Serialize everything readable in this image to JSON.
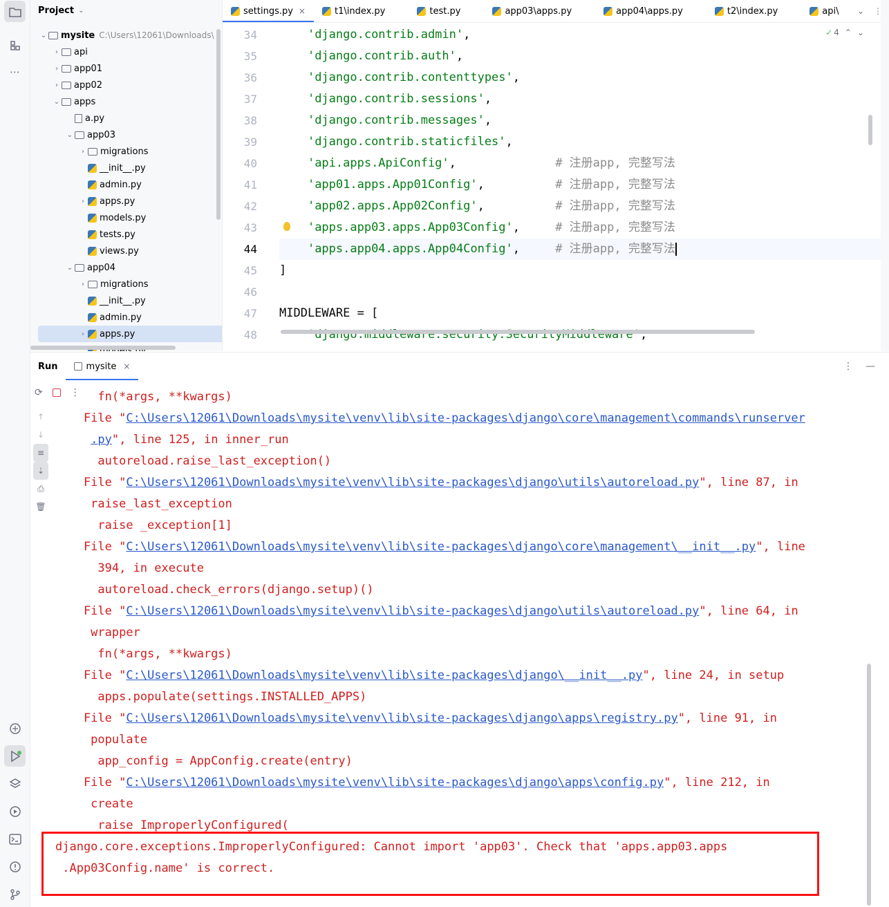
{
  "project": {
    "title": "Project",
    "root_name": "mysite",
    "root_path": "C:\\Users\\12061\\Downloads\\",
    "items": [
      {
        "label": "api",
        "type": "folder",
        "chevron": "right"
      },
      {
        "label": "app01",
        "type": "folder",
        "chevron": "right"
      },
      {
        "label": "app02",
        "type": "folder",
        "chevron": "right"
      },
      {
        "label": "apps",
        "type": "folder",
        "chevron": "down"
      },
      {
        "label": "a.py",
        "type": "file",
        "chevron": ""
      },
      {
        "label": "app03",
        "type": "folder",
        "chevron": "down"
      },
      {
        "label": "migrations",
        "type": "folder",
        "chevron": "right"
      },
      {
        "label": "__init__.py",
        "type": "py",
        "chevron": ""
      },
      {
        "label": "admin.py",
        "type": "py",
        "chevron": ""
      },
      {
        "label": "apps.py",
        "type": "py",
        "chevron": "right"
      },
      {
        "label": "models.py",
        "type": "py",
        "chevron": ""
      },
      {
        "label": "tests.py",
        "type": "py",
        "chevron": ""
      },
      {
        "label": "views.py",
        "type": "py",
        "chevron": ""
      },
      {
        "label": "app04",
        "type": "folder",
        "chevron": "down"
      },
      {
        "label": "migrations",
        "type": "folder",
        "chevron": "right"
      },
      {
        "label": "__init__.py",
        "type": "py",
        "chevron": ""
      },
      {
        "label": "admin.py",
        "type": "py",
        "chevron": ""
      },
      {
        "label": "apps.py",
        "type": "py",
        "chevron": "right"
      },
      {
        "label": "models.py",
        "type": "py",
        "chevron": ""
      }
    ]
  },
  "editor": {
    "tabs": [
      "settings.py",
      "t1\\index.py",
      "test.py",
      "app03\\apps.py",
      "app04\\apps.py",
      "t2\\index.py",
      "api\\"
    ],
    "inspection_count": "4",
    "line_numbers": [
      "34",
      "35",
      "36",
      "37",
      "38",
      "39",
      "40",
      "41",
      "42",
      "43",
      "44",
      "45",
      "46",
      "47",
      "48"
    ],
    "lines": [
      {
        "s": "'django.contrib.admin'",
        "t": ",",
        "c": ""
      },
      {
        "s": "'django.contrib.auth'",
        "t": ",",
        "c": ""
      },
      {
        "s": "'django.contrib.contenttypes'",
        "t": ",",
        "c": ""
      },
      {
        "s": "'django.contrib.sessions'",
        "t": ",",
        "c": ""
      },
      {
        "s": "'django.contrib.messages'",
        "t": ",",
        "c": ""
      },
      {
        "s": "'django.contrib.staticfiles'",
        "t": ",",
        "c": ""
      },
      {
        "s": "'api.apps.ApiConfig'",
        "t": ",              ",
        "c": "# 注册app, 完整写法"
      },
      {
        "s": "'app01.apps.App01Config'",
        "t": ",          ",
        "c": "# 注册app, 完整写法"
      },
      {
        "s": "'app02.apps.App02Config'",
        "t": ",          ",
        "c": "# 注册app, 完整写法"
      },
      {
        "s": "'apps.app03.apps.App03Config'",
        "t": ",     ",
        "c": "# 注册app, 完整写法"
      },
      {
        "s": "'apps.app04.apps.App04Config'",
        "t": ",     ",
        "c": "# 注册app, 完整写法"
      },
      {
        "p": "]"
      },
      {
        "p": ""
      },
      {
        "p": "MIDDLEWARE = ["
      },
      {
        "s": "'django.middleware.security.SecurityMiddleware'",
        "t": ",",
        "c": ""
      }
    ]
  },
  "run": {
    "title": "Run",
    "tab_label": "mysite",
    "console": [
      {
        "pre": "      fn(*args, **kwargs)"
      },
      {
        "pre": "    File \"",
        "link": "C:\\Users\\12061\\Downloads\\mysite\\venv\\lib\\site-packages\\django\\core\\management\\commands\\runserver",
        "post": ""
      },
      {
        "pre": "     ",
        "link": ".py",
        "post": "\", line 125, in inner_run"
      },
      {
        "pre": "      autoreload.raise_last_exception()"
      },
      {
        "pre": "    File \"",
        "link": "C:\\Users\\12061\\Downloads\\mysite\\venv\\lib\\site-packages\\django\\utils\\autoreload.py",
        "post": "\", line 87, in"
      },
      {
        "pre": "     raise_last_exception"
      },
      {
        "pre": "      raise _exception[1]"
      },
      {
        "pre": "    File \"",
        "link": "C:\\Users\\12061\\Downloads\\mysite\\venv\\lib\\site-packages\\django\\core\\management\\__init__.py",
        "post": "\", line"
      },
      {
        "pre": "      394, in execute"
      },
      {
        "pre": "      autoreload.check_errors(django.setup)()"
      },
      {
        "pre": "    File \"",
        "link": "C:\\Users\\12061\\Downloads\\mysite\\venv\\lib\\site-packages\\django\\utils\\autoreload.py",
        "post": "\", line 64, in"
      },
      {
        "pre": "     wrapper"
      },
      {
        "pre": "      fn(*args, **kwargs)"
      },
      {
        "pre": "    File \"",
        "link": "C:\\Users\\12061\\Downloads\\mysite\\venv\\lib\\site-packages\\django\\__init__.py",
        "post": "\", line 24, in setup"
      },
      {
        "pre": "      apps.populate(settings.INSTALLED_APPS)"
      },
      {
        "pre": "    File \"",
        "link": "C:\\Users\\12061\\Downloads\\mysite\\venv\\lib\\site-packages\\django\\apps\\registry.py",
        "post": "\", line 91, in"
      },
      {
        "pre": "     populate"
      },
      {
        "pre": "      app_config = AppConfig.create(entry)"
      },
      {
        "pre": "    File \"",
        "link": "C:\\Users\\12061\\Downloads\\mysite\\venv\\lib\\site-packages\\django\\apps\\config.py",
        "post": "\", line 212, in"
      },
      {
        "pre": "     create"
      },
      {
        "pre": "      raise ImproperlyConfigured("
      },
      {
        "pre": "django.core.exceptions.ImproperlyConfigured: Cannot import 'app03'. Check that 'apps.app03.apps"
      },
      {
        "pre": " .App03Config.name' is correct."
      }
    ]
  },
  "colors": {
    "accent": "#3574f0",
    "error": "#cf2020",
    "link": "#2a59c8",
    "highlight": "#ff1111",
    "string": "#067d17",
    "comment": "#8c8c8c"
  },
  "icons": [
    "folder-icon",
    "structure-icon",
    "more-icon",
    "python-console-icon",
    "run-icon",
    "layers-icon",
    "services-icon",
    "terminal-icon",
    "problems-icon",
    "git-icon"
  ]
}
